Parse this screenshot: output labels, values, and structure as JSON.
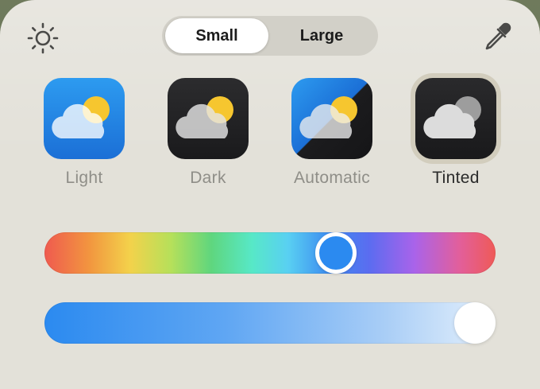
{
  "toolbar": {
    "brightness_icon": "sun-icon",
    "eyedropper_icon": "eyedropper-icon"
  },
  "size_toggle": {
    "options": [
      "Small",
      "Large"
    ],
    "selected": "Small"
  },
  "variants": [
    {
      "label": "Light",
      "style": "light",
      "selected": false
    },
    {
      "label": "Dark",
      "style": "dark",
      "selected": false
    },
    {
      "label": "Automatic",
      "style": "automatic",
      "selected": false
    },
    {
      "label": "Tinted",
      "style": "tinted",
      "selected": true
    }
  ],
  "hue_slider": {
    "value": 0.66,
    "thumb_color": "#2b8af0"
  },
  "saturation_slider": {
    "value": 1.0,
    "thumb_color": "#ffffff"
  },
  "colors": {
    "panel_bg": "#e3e1d9",
    "toggle_bg": "#d2d0c8",
    "selected_ring": "#d2cdbd",
    "label_inactive": "#8f8e88",
    "label_active": "#2b2b2b",
    "sun_color": "#f6c62f"
  }
}
